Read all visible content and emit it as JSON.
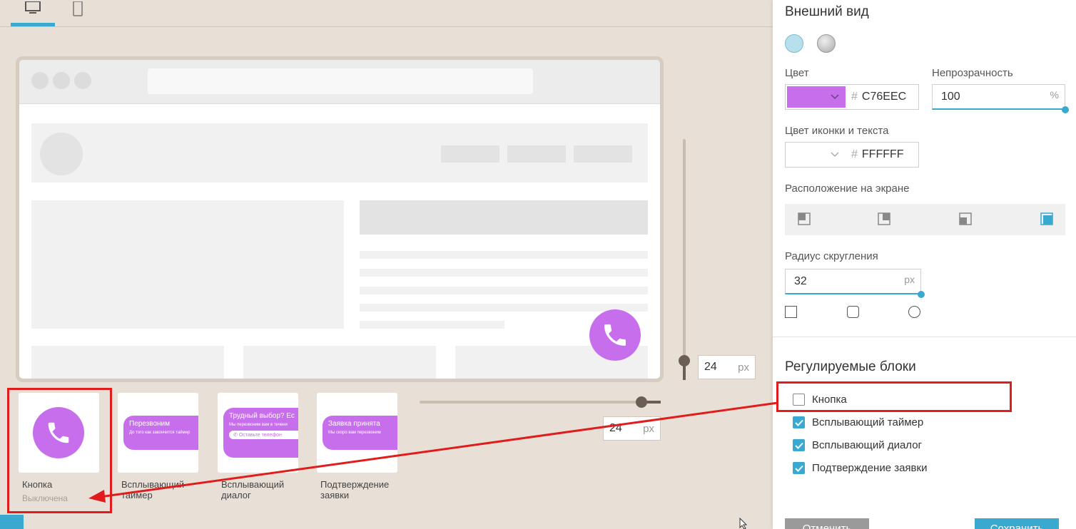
{
  "colors": {
    "accent": "#3aa9cf",
    "brand_purple": "#c76eec",
    "annotation_red": "#e01c1c",
    "background": "#e8e0d7"
  },
  "device_tabs": [
    {
      "icon": "desktop-icon",
      "active": true
    },
    {
      "icon": "mobile-icon",
      "active": false
    }
  ],
  "preview": {
    "fab_icon": "phone-icon",
    "vertical_offset": {
      "value": "24",
      "unit": "px"
    },
    "horizontal_offset": {
      "value": "24",
      "unit": "px"
    }
  },
  "blocks": [
    {
      "label": "Кнопка",
      "status": "Выключена"
    },
    {
      "label": "Всплывающий\nтаймер",
      "pill_title": "Перезвоним",
      "pill_text": "До того как закончится таймер"
    },
    {
      "label": "Всплывающий\nдиалог",
      "pill_title": "Трудный выбор? Ес",
      "pill_text": "Мы перезвоним вам в течени",
      "pill_input": "Оставьте телефон"
    },
    {
      "label": "Подтверждение\nзаявки",
      "pill_title": "Заявка принята",
      "pill_text": "Мы скоро вам перезвоним"
    }
  ],
  "panel": {
    "appearance_title": "Внешний вид",
    "color_label": "Цвет",
    "color_value": "C76EEC",
    "opacity_label": "Непрозрачность",
    "opacity_value": "100",
    "opacity_unit": "%",
    "icon_color_label": "Цвет иконки и текста",
    "icon_color_value": "FFFFFF",
    "hash": "#",
    "position_label": "Расположение на экране",
    "radius_label": "Радиус скругления",
    "radius_value": "32",
    "radius_unit": "px",
    "blocks_title": "Регулируемые блоки",
    "toggles": [
      {
        "label": "Кнопка",
        "checked": false
      },
      {
        "label": "Всплывающий таймер",
        "checked": true
      },
      {
        "label": "Всплывающий диалог",
        "checked": true
      },
      {
        "label": "Подтверждение заявки",
        "checked": true
      }
    ],
    "cancel_label": "Отменить",
    "save_label": "Сохранить"
  }
}
